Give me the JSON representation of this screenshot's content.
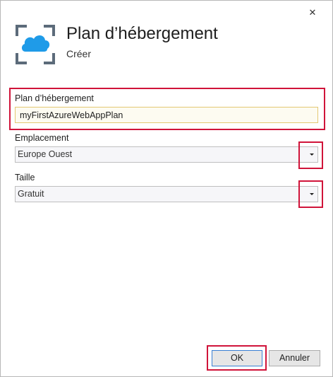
{
  "dialog": {
    "close_glyph": "✕",
    "title": "Plan d’hébergement",
    "subtitle": "Créer",
    "icon": "app-service-plan-cloud-icon"
  },
  "form": {
    "plan_label": "Plan d’hébergement",
    "plan_value": "myFirstAzureWebAppPlan",
    "location_label": "Emplacement",
    "location_value": "Europe Ouest",
    "size_label": "Taille",
    "size_value": "Gratuit"
  },
  "buttons": {
    "ok": "OK",
    "cancel": "Annuler"
  },
  "colors": {
    "highlight": "#d0143a",
    "cloud": "#1f9be8",
    "frame": "#5c6b7a"
  }
}
